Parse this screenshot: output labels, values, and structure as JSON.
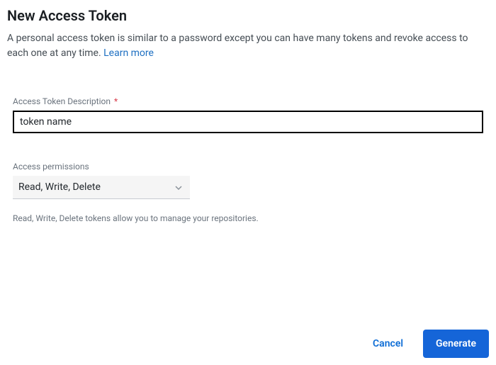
{
  "header": {
    "title": "New Access Token",
    "subtitle_prefix": "A personal access token is similar to a password except you can have many tokens and revoke access to each one at any time. ",
    "learn_more": "Learn more"
  },
  "form": {
    "description_label": "Access Token Description",
    "required_mark": "*",
    "description_value": "token name",
    "permissions_label": "Access permissions",
    "permissions_value": "Read, Write, Delete",
    "helper_text": "Read, Write, Delete tokens allow you to manage your repositories."
  },
  "footer": {
    "cancel_label": "Cancel",
    "generate_label": "Generate"
  }
}
